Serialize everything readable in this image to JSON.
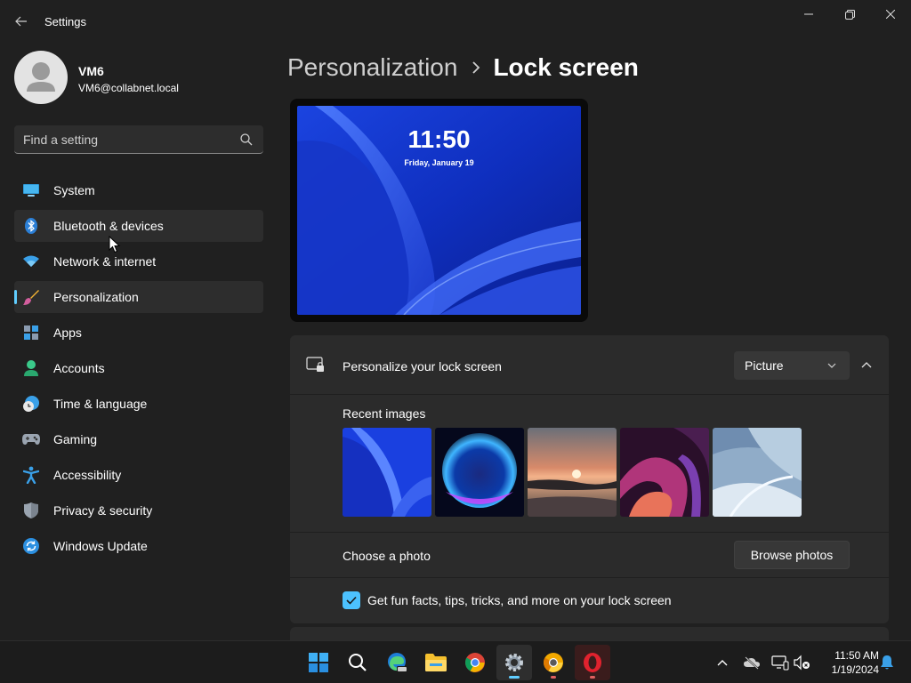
{
  "window": {
    "title": "Settings"
  },
  "profile": {
    "name": "VM6",
    "email": "VM6@collabnet.local"
  },
  "search": {
    "placeholder": "Find a setting"
  },
  "sidebar": {
    "items": [
      {
        "label": "System",
        "icon": "monitor-icon"
      },
      {
        "label": "Bluetooth & devices",
        "icon": "bluetooth-icon"
      },
      {
        "label": "Network & internet",
        "icon": "wifi-icon"
      },
      {
        "label": "Personalization",
        "icon": "paintbrush-icon"
      },
      {
        "label": "Apps",
        "icon": "apps-icon"
      },
      {
        "label": "Accounts",
        "icon": "person-icon"
      },
      {
        "label": "Time & language",
        "icon": "clock-globe-icon"
      },
      {
        "label": "Gaming",
        "icon": "gamepad-icon"
      },
      {
        "label": "Accessibility",
        "icon": "accessibility-icon"
      },
      {
        "label": "Privacy & security",
        "icon": "shield-icon"
      },
      {
        "label": "Windows Update",
        "icon": "update-icon"
      }
    ],
    "selected": "Personalization",
    "hovered": "Bluetooth & devices"
  },
  "breadcrumb": {
    "parent": "Personalization",
    "current": "Lock screen"
  },
  "preview": {
    "time": "11:50",
    "date": "Friday, January 19"
  },
  "lock_card": {
    "title": "Personalize your lock screen",
    "dropdown_value": "Picture",
    "recent_images_label": "Recent images",
    "choose_photo_label": "Choose a photo",
    "browse_button": "Browse photos",
    "fun_facts_label": "Get fun facts, tips, tricks, and more on your lock screen",
    "fun_facts_checked": true
  },
  "taskbar": {
    "time": "11:50 AM",
    "date": "1/19/2024"
  },
  "colors": {
    "accent": "#60cdff",
    "background": "#202020",
    "card": "#2b2b2b"
  }
}
